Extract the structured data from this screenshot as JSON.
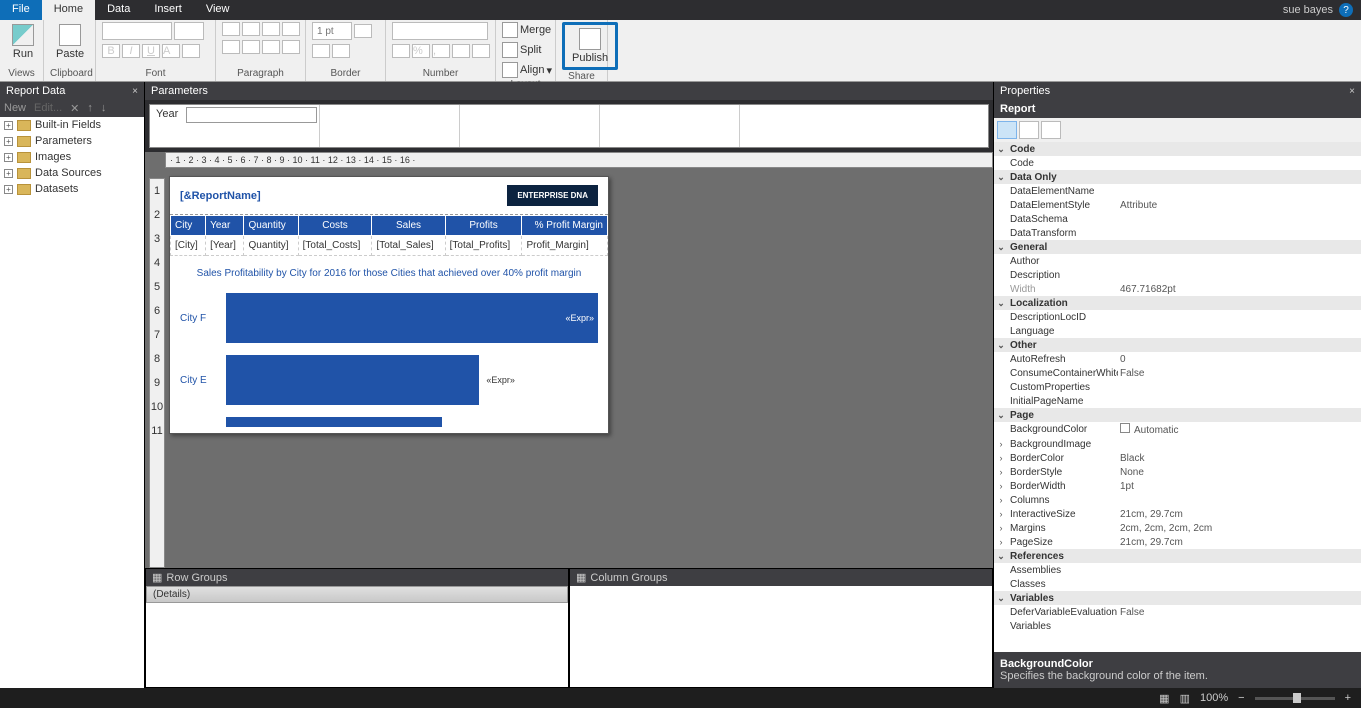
{
  "tabs": {
    "file": "File",
    "home": "Home",
    "data": "Data",
    "insert": "Insert",
    "view": "View"
  },
  "user": "sue bayes",
  "ribbon": {
    "views": {
      "run": "Run",
      "label": "Views"
    },
    "clipboard": {
      "paste": "Paste",
      "label": "Clipboard"
    },
    "font": {
      "label": "Font"
    },
    "paragraph": {
      "label": "Paragraph"
    },
    "border": {
      "label": "Border",
      "pt": "1 pt"
    },
    "number": {
      "label": "Number"
    },
    "layout": {
      "label": "Layout",
      "merge": "Merge",
      "split": "Split",
      "align": "Align"
    },
    "share": {
      "label": "Share",
      "publish": "Publish"
    }
  },
  "panels": {
    "reportData": "Report Data",
    "parameters": "Parameters",
    "properties": "Properties",
    "rowGroups": "Row Groups",
    "colGroups": "Column Groups"
  },
  "reportData": {
    "new": "New",
    "edit": "Edit...",
    "items": [
      "Built-in Fields",
      "Parameters",
      "Images",
      "Data Sources",
      "Datasets"
    ]
  },
  "param": {
    "year": "Year"
  },
  "ruler_h": "· 1 · 2 · 3 · 4 · 5 · 6 · 7 · 8 · 9 · 10 · 11 · 12 · 13 · 14 · 15 · 16 ·",
  "ruler_v": [
    "1",
    "2",
    "3",
    "4",
    "5",
    "6",
    "7",
    "8",
    "9",
    "10",
    "11"
  ],
  "page": {
    "title": "[&ReportName]",
    "logo": "ENTERPRISE DNA",
    "headers": [
      "City",
      "Year",
      "Quantity",
      "Costs",
      "Sales",
      "Profits",
      "% Profit Margin"
    ],
    "cells": [
      "[City]",
      "[Year]",
      "Quantity]",
      "[Total_Costs]",
      "[Total_Sales]",
      "[Total_Profits]",
      "Profit_Margin]"
    ],
    "chart_title": "Sales Profitability by City for 2016 for those Cities that achieved over 40% profit margin",
    "bars": [
      {
        "label": "City F",
        "expr": "«Expr»",
        "w": 100
      },
      {
        "label": "City E",
        "expr": "«Expr»",
        "w": 68
      }
    ]
  },
  "rowGroups": {
    "details": "(Details)"
  },
  "props": {
    "subhdr": "Report",
    "cats": [
      {
        "name": "Code",
        "rows": [
          [
            "Code",
            ""
          ]
        ]
      },
      {
        "name": "Data Only",
        "rows": [
          [
            "DataElementName",
            ""
          ],
          [
            "DataElementStyle",
            "Attribute"
          ],
          [
            "DataSchema",
            ""
          ],
          [
            "DataTransform",
            ""
          ]
        ]
      },
      {
        "name": "General",
        "rows": [
          [
            "Author",
            ""
          ],
          [
            "Description",
            ""
          ],
          [
            "Width",
            "467.71682pt"
          ]
        ]
      },
      {
        "name": "Localization",
        "rows": [
          [
            "DescriptionLocID",
            ""
          ],
          [
            "Language",
            ""
          ]
        ]
      },
      {
        "name": "Other",
        "rows": [
          [
            "AutoRefresh",
            "0"
          ],
          [
            "ConsumeContainerWhitespace",
            "False"
          ],
          [
            "CustomProperties",
            ""
          ],
          [
            "InitialPageName",
            ""
          ]
        ]
      },
      {
        "name": "Page",
        "rows": [
          [
            "BackgroundColor",
            "Automatic"
          ],
          [
            "BackgroundImage",
            ""
          ],
          [
            "BorderColor",
            "Black"
          ],
          [
            "BorderStyle",
            "None"
          ],
          [
            "BorderWidth",
            "1pt"
          ],
          [
            "Columns",
            ""
          ],
          [
            "InteractiveSize",
            "21cm, 29.7cm"
          ],
          [
            "Margins",
            "2cm, 2cm, 2cm, 2cm"
          ],
          [
            "PageSize",
            "21cm, 29.7cm"
          ]
        ]
      },
      {
        "name": "References",
        "rows": [
          [
            "Assemblies",
            ""
          ],
          [
            "Classes",
            ""
          ]
        ]
      },
      {
        "name": "Variables",
        "rows": [
          [
            "DeferVariableEvaluation",
            "False"
          ],
          [
            "Variables",
            ""
          ]
        ]
      }
    ],
    "desc_title": "BackgroundColor",
    "desc_text": "Specifies the background color of the item."
  },
  "status": {
    "zoom": "100%"
  }
}
